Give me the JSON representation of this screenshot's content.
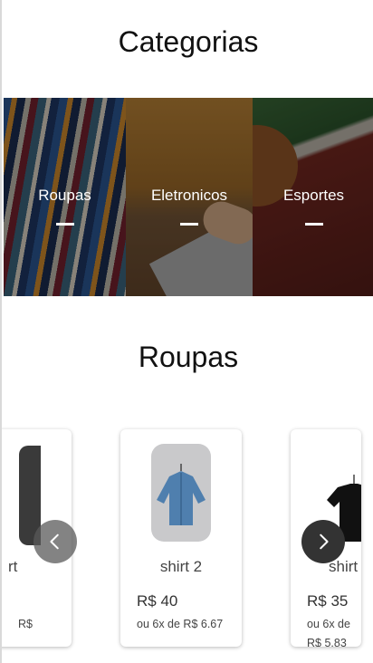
{
  "categories_section": {
    "title": "Categorias",
    "items": [
      {
        "label": "Roupas"
      },
      {
        "label": "Eletronicos"
      },
      {
        "label": "Esportes"
      }
    ]
  },
  "products_section": {
    "title": "Roupas",
    "products": [
      {
        "name": "rt",
        "price": "",
        "installment": "R$",
        "icon": "shirt-icon"
      },
      {
        "name": "shirt 2",
        "price": "R$ 40",
        "installment": "ou 6x de R$ 6.67",
        "icon": "denim-shirt-icon"
      },
      {
        "name": "shirt",
        "price": "R$ 35",
        "installment": "ou 6x de R$ 5.83",
        "icon": "black-tshirt-icon"
      }
    ],
    "prev_icon": "chevron-left-icon",
    "next_icon": "chevron-right-icon"
  }
}
